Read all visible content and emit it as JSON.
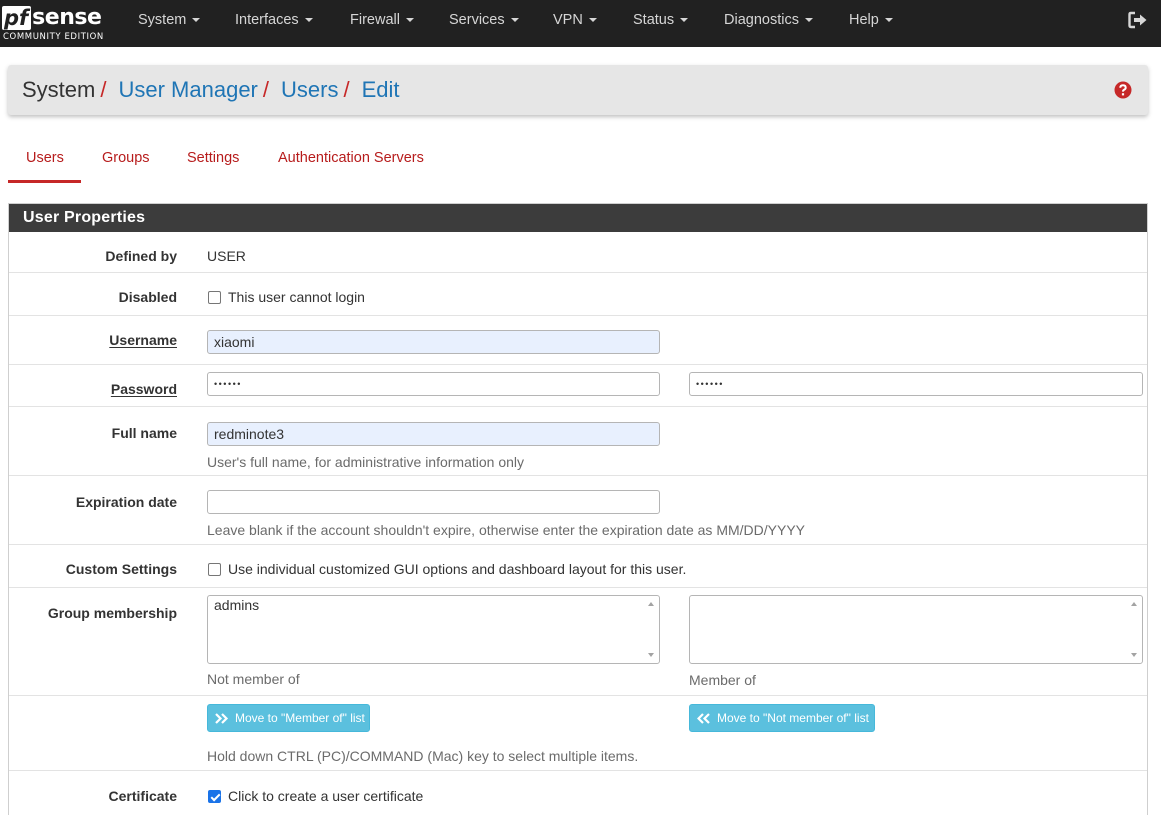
{
  "brand": {
    "logo_pf": "pf",
    "logo_sense": "sense",
    "edition": "COMMUNITY EDITION"
  },
  "nav": {
    "items": [
      "System",
      "Interfaces",
      "Firewall",
      "Services",
      "VPN",
      "Status",
      "Diagnostics",
      "Help"
    ],
    "logout_icon": "sign-out-icon"
  },
  "breadcrumb": {
    "root": "System",
    "separator": "/",
    "links": [
      "User Manager",
      "Users",
      "Edit"
    ],
    "help_icon": "question-circle-icon"
  },
  "tabs": [
    {
      "label": "Users",
      "active": true
    },
    {
      "label": "Groups",
      "active": false
    },
    {
      "label": "Settings",
      "active": false
    },
    {
      "label": "Authentication Servers",
      "active": false
    }
  ],
  "panel": {
    "title": "User Properties",
    "defined_by": {
      "label": "Defined by",
      "value": "USER"
    },
    "disabled": {
      "label": "Disabled",
      "checkbox_label": "This user cannot login",
      "checked": false
    },
    "username": {
      "label": "Username",
      "value": "xiaomi"
    },
    "password": {
      "label": "Password",
      "value": "••••••",
      "confirm_value": "••••••"
    },
    "full_name": {
      "label": "Full name",
      "value": "redminote3",
      "help": "User's full name, for administrative information only"
    },
    "expiration": {
      "label": "Expiration date",
      "value": "",
      "help": "Leave blank if the account shouldn't expire, otherwise enter the expiration date as MM/DD/YYYY"
    },
    "custom_settings": {
      "label": "Custom Settings",
      "checkbox_label": "Use individual customized GUI options and dashboard layout for this user.",
      "checked": false
    },
    "group_membership": {
      "label": "Group membership",
      "not_member_of": [
        "admins"
      ],
      "member_of": [],
      "not_member_caption": "Not member of",
      "member_caption": "Member of"
    },
    "move_buttons": {
      "to_member": "Move to \"Member of\" list",
      "to_not_member": "Move to \"Not member of\" list",
      "help": "Hold down CTRL (PC)/COMMAND (Mac) key to select multiple items."
    },
    "certificate": {
      "label": "Certificate",
      "checkbox_label": "Click to create a user certificate",
      "checked": true
    }
  },
  "colors": {
    "navbar": "#212121",
    "link_blue": "#1f75b5",
    "tab_red": "#b71c1c",
    "panel_heading": "#3c3c3c",
    "button_info": "#5bc0de",
    "help_icon_red": "#c62828"
  }
}
